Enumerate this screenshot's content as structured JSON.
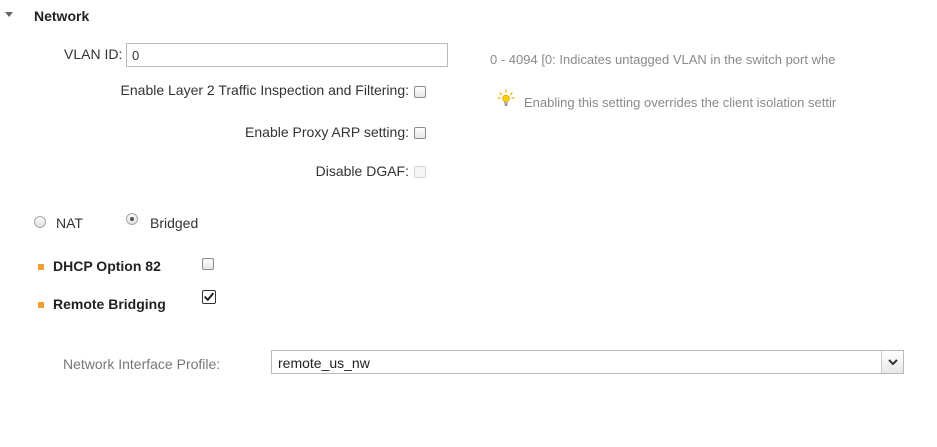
{
  "network": {
    "title": "Network",
    "vlan": {
      "label": "VLAN ID:",
      "value": "0",
      "hint": "0 - 4094 [0: Indicates untagged VLAN in the switch port whe"
    },
    "layer2": {
      "label": "Enable Layer 2 Traffic Inspection and Filtering:",
      "checked": false,
      "hint": "Enabling this setting overrides the client isolation settir"
    },
    "proxy_arp": {
      "label": "Enable Proxy ARP setting:",
      "checked": false
    },
    "dgaf": {
      "label": "Disable DGAF:",
      "checked": false,
      "disabled": true
    },
    "mode": {
      "options": [
        "NAT",
        "Bridged"
      ],
      "selected": "Bridged"
    },
    "dhcp_option_82": {
      "label": "DHCP Option 82",
      "checked": false
    },
    "remote_bridging": {
      "label": "Remote Bridging",
      "checked": true
    },
    "network_interface_profile": {
      "label": "Network Interface Profile:",
      "value": "remote_us_nw"
    }
  },
  "colors": {
    "bullet": "#f0a030",
    "hint_text": "#8a8a8a",
    "hint_icon": "#f2b600"
  }
}
